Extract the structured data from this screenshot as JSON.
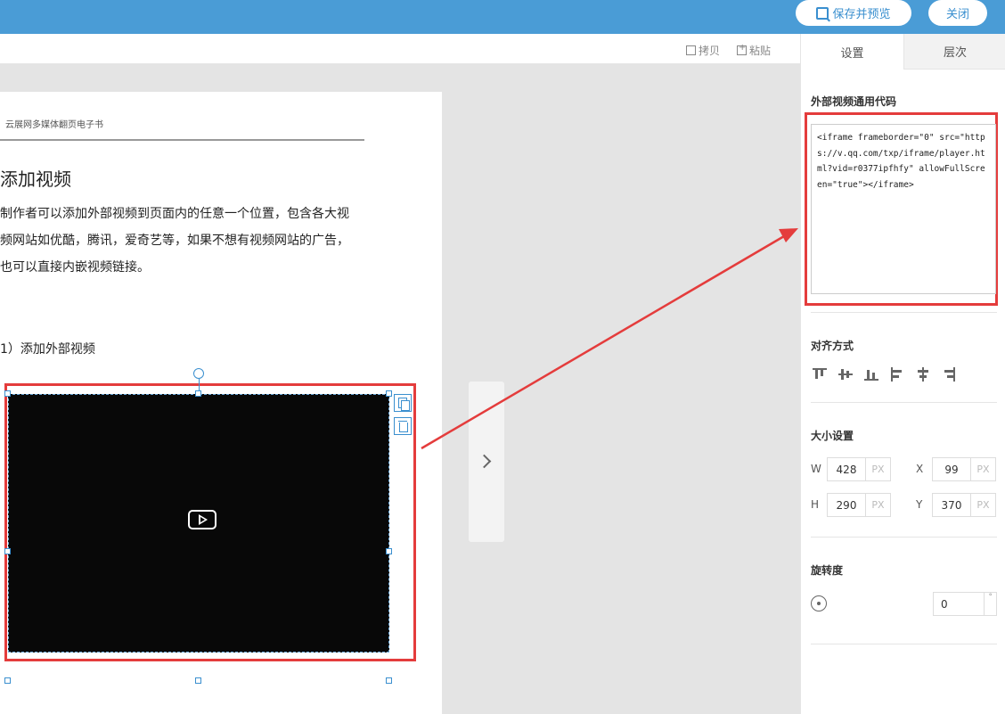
{
  "header": {
    "preview_label": "保存并预览",
    "close_label": "关闭"
  },
  "toolbar": {
    "copy_label": "拷贝",
    "paste_label": "粘贴"
  },
  "page": {
    "header_text": "云展网多媒体翻页电子书",
    "title": "添加视频",
    "paragraph_lines": [
      "制作者可以添加外部视频到页面内的任意一个位置，包含各大视",
      "频网站如优酷，腾讯，爱奇艺等，如果不想有视频网站的广告，",
      "也可以直接内嵌视频链接。"
    ],
    "subheading": "1）添加外部视频"
  },
  "panel": {
    "tabs": [
      "设置",
      "层次"
    ],
    "video_code_label": "外部视频通用代码",
    "video_code": "<iframe frameborder=\"0\" src=\"https://v.qq.com/txp/iframe/player.html?vid=r0377ipfhfy\" allowFullScreen=\"true\"></iframe>",
    "align_label": "对齐方式",
    "align_icons": [
      "align-top-icon",
      "align-vcenter-icon",
      "align-bottom-icon",
      "align-left-icon",
      "align-hcenter-icon",
      "align-right-icon"
    ],
    "size_label": "大小设置",
    "size": {
      "w_label": "W",
      "w_value": "428",
      "h_label": "H",
      "h_value": "290",
      "x_label": "X",
      "x_value": "99",
      "y_label": "Y",
      "y_value": "370",
      "unit": "PX"
    },
    "rotation_label": "旋转度",
    "rotation_value": "0",
    "rotation_unit": "°"
  },
  "colors": {
    "topbar": "#4a9cd6",
    "highlight": "#e43c3c",
    "selection": "#3a8fcf"
  }
}
